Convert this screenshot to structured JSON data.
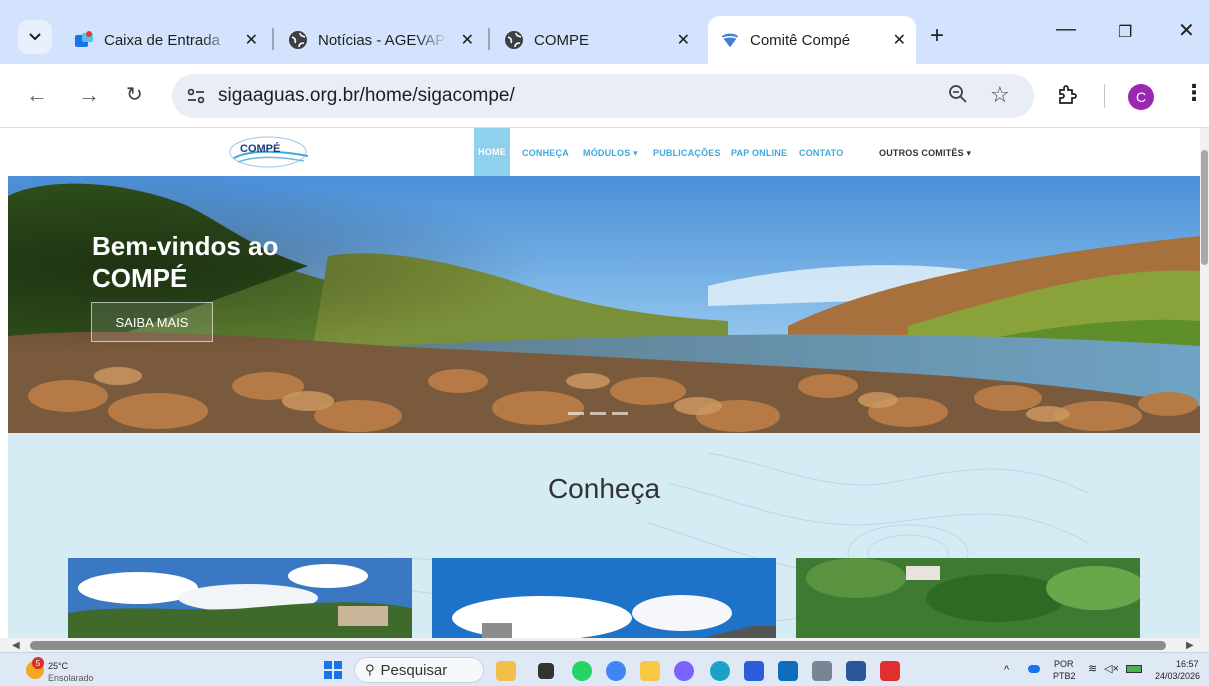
{
  "browser": {
    "tabs": [
      {
        "title": "Caixa de Entrada",
        "icon": "outlook-icon",
        "active": false
      },
      {
        "title": "Notícias - AGEVAP",
        "icon": "globe-icon",
        "active": false
      },
      {
        "title": "COMPE",
        "icon": "globe-icon",
        "active": false
      },
      {
        "title": "Comitê Compé",
        "icon": "compe-favicon",
        "active": true
      }
    ],
    "url": "sigaaguas.org.br/home/sigacompe/",
    "profile_initial": "C"
  },
  "site": {
    "logo_text": "COMPÉ",
    "nav": [
      {
        "label": "HOME",
        "active": true
      },
      {
        "label": "CONHEÇA"
      },
      {
        "label": "MÓDULOS ▾"
      },
      {
        "label": "PUBLICAÇÕES"
      },
      {
        "label": "PAP ONLINE"
      },
      {
        "label": "CONTATO"
      }
    ],
    "other_committees": "OUTROS COMITÊS ▾",
    "hero": {
      "title": "Bem-vindos ao COMPÉ",
      "button": "SAIBA MAIS"
    },
    "section_title": "Conheça"
  },
  "taskbar": {
    "weather_temp": "25°C",
    "weather_desc": "Ensolarado",
    "weather_badge": "5",
    "search_label": "Pesquisar",
    "lang_top": "POR",
    "lang_bottom": "PTB2",
    "time": "16:57",
    "date": "24/03/2026"
  }
}
